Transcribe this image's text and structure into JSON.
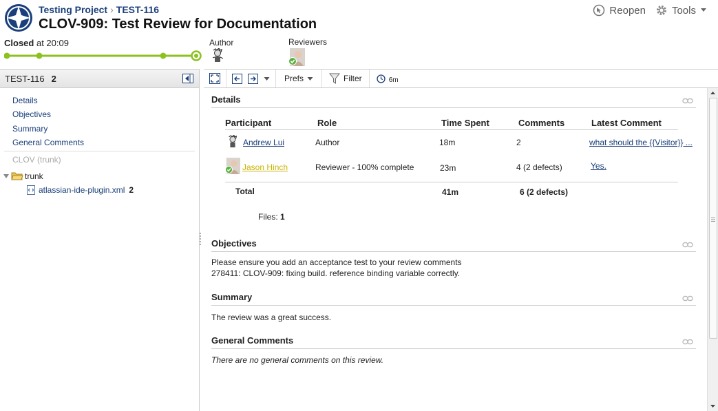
{
  "header": {
    "breadcrumb": {
      "project": "Testing Project",
      "separator": "›",
      "review_id": "TEST-116"
    },
    "title": "CLOV-909: Test Review for Documentation",
    "actions": {
      "reopen": "Reopen",
      "tools": "Tools"
    },
    "status": {
      "state": "Closed",
      "at_text": "at 20:09"
    },
    "people": {
      "author_label": "Author",
      "reviewers_label": "Reviewers"
    }
  },
  "left_panel": {
    "title": "TEST-116",
    "count": "2",
    "links": [
      "Details",
      "Objectives",
      "Summary",
      "General Comments"
    ],
    "repo": "CLOV (trunk)",
    "tree": {
      "folder": "trunk",
      "file": "atlassian-ide-plugin.xml",
      "file_count": "2"
    }
  },
  "toolbar": {
    "prefs": "Prefs",
    "filter": "Filter",
    "time": "6m"
  },
  "details": {
    "heading": "Details",
    "columns": [
      "Participant",
      "Role",
      "Time Spent",
      "Comments",
      "Latest Comment"
    ],
    "rows": [
      {
        "participant": "Andrew Lui",
        "role": "Author",
        "time": "18m",
        "comments": "2",
        "latest": "what should the {{Visitor}} ..."
      },
      {
        "participant": "Jason Hinch",
        "role": "Reviewer - 100% complete",
        "time": "23m",
        "comments": "4 (2 defects)",
        "latest": "Yes."
      }
    ],
    "total": {
      "label": "Total",
      "time": "41m",
      "comments": "6 (2 defects)"
    },
    "files": {
      "label": "Files:",
      "value": "1"
    }
  },
  "objectives": {
    "heading": "Objectives",
    "line1": "Please ensure you add an acceptance test to your review comments",
    "line2": "278411: CLOV-909: fixing build. reference binding variable correctly."
  },
  "summary": {
    "heading": "Summary",
    "text": "The review was a great success."
  },
  "general_comments": {
    "heading": "General Comments",
    "text": "There are no general comments on this review."
  },
  "colors": {
    "accent": "#1a3f7a",
    "progress": "#8cc11f",
    "link_yellow": "#c8b400"
  }
}
